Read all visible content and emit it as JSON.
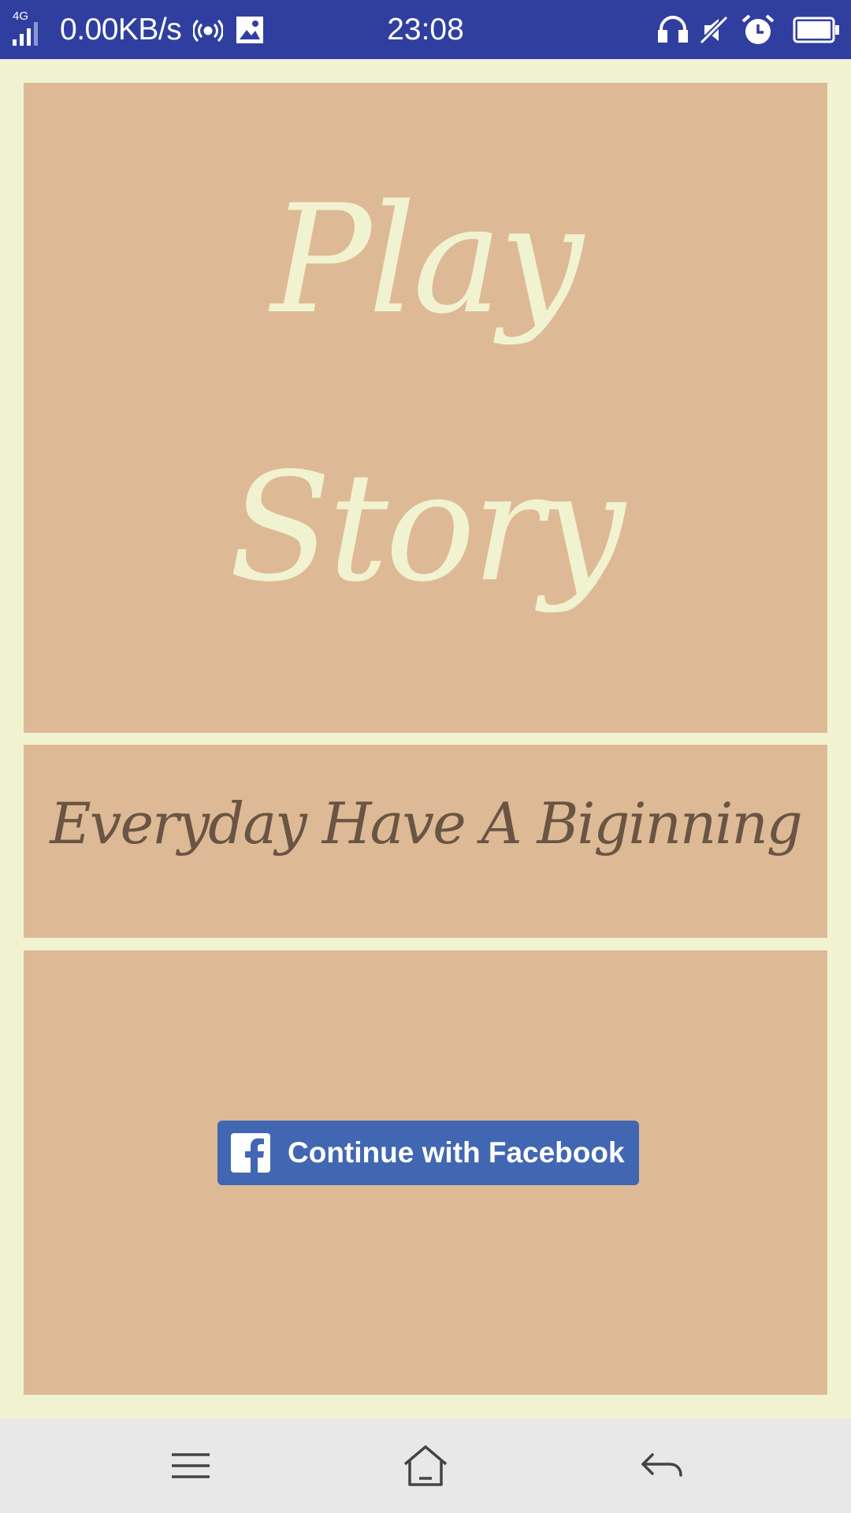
{
  "status_bar": {
    "network_type": "4G",
    "speed": "0.00KB/s",
    "time": "23:08",
    "icons": [
      "signal-icon",
      "hotspot-icon",
      "image-icon",
      "headset-icon",
      "mute-icon",
      "alarm-icon",
      "battery-icon"
    ]
  },
  "app": {
    "title_line1": "Play",
    "title_line2": "Story",
    "tagline": "Everyday Have A Biginning",
    "facebook_button_label": "Continue with Facebook"
  },
  "nav_bar": {
    "icons": [
      "menu-icon",
      "home-icon",
      "back-icon"
    ]
  },
  "colors": {
    "status_bar": "#303f9f",
    "background": "#f1f3d0",
    "panel": "#ddba95",
    "title_text": "#f1f3d0",
    "tagline_text": "#6a5544",
    "facebook_blue": "#4267b2",
    "nav_bar": "#e8e8e8"
  }
}
